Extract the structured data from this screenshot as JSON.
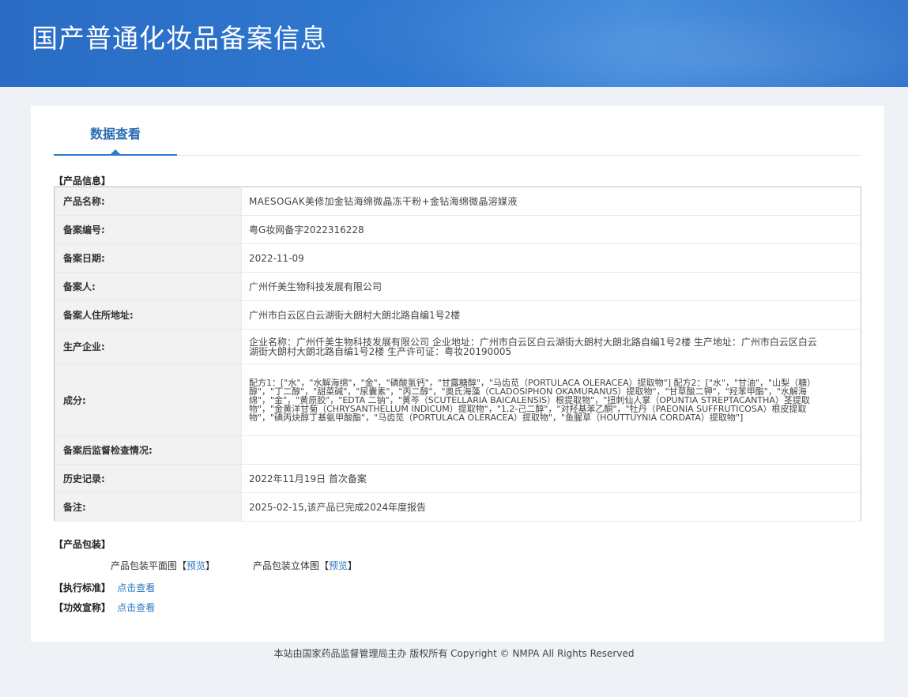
{
  "header": {
    "title": "国产普通化妆品备案信息"
  },
  "tabs": [
    {
      "label": "数据查看"
    }
  ],
  "product_info": {
    "section_title": "【产品信息】",
    "rows": [
      {
        "label": "产品名称:",
        "value": "MAESOGAK美修加金钻海绵微晶冻干粉+金钻海绵微晶溶媒液"
      },
      {
        "label": "备案编号:",
        "value": "粤G妆网备字2022316228"
      },
      {
        "label": "备案日期:",
        "value": "2022-11-09"
      },
      {
        "label": "备案人:",
        "value": "广州仟美生物科技发展有限公司"
      },
      {
        "label": "备案人住所地址:",
        "value": "广州市白云区白云湖街大朗村大朗北路自编1号2楼"
      },
      {
        "label": "生产企业:",
        "value": "企业名称：广州仟美生物科技发展有限公司 企业地址：广州市白云区白云湖街大朗村大朗北路自编1号2楼 生产地址：广州市白云区白云湖街大朗村大朗北路自编1号2楼 生产许可证：粤妆20190005"
      },
      {
        "label": "成分:",
        "value": "配方1：[\"水\"，\"水解海绵\"，\"金\"，\"磷酸氢钙\"，\"甘露糖醇\"，\"马齿苋（PORTULACA OLERACEA）提取物\"] 配方2：[\"水\"，\"甘油\"，\"山梨（糖）醇\"，\"丁二醇\"，\"甜菜碱\"，\"尿囊素\"，\"丙二醇\"，\"奥氏海藻（CLADOSIPHON OKAMURANUS）提取物\"，\"甘草酸二钾\"，\"羟苯甲酯\"，\"水解海绵\"，\"金\"，\"黄原胶\"，\"EDTA 二钠\"，\"黄芩（SCUTELLARIA BAICALENSIS）根提取物\"，\"扭刺仙人掌（OPUNTIA STREPTACANTHA）茎提取物\"，\"金黄洋甘菊（CHRYSANTHELLUM INDICUM）提取物\"，\"1,2-己二醇\"，\"对羟基苯乙酮\"，\"牡丹（PAEONIA SUFFRUTICOSA）根皮提取物\"，\"碘丙炔醇丁基氨甲酸酯\"，\"马齿苋（PORTULACA OLERACEA）提取物\"，\"鱼腥草（HOUTTUYNIA CORDATA）提取物\"]"
      },
      {
        "label": "备案后监督检查情况:",
        "value": ""
      },
      {
        "label": "历史记录:",
        "value": "2022年11月19日 首次备案"
      },
      {
        "label": "备注:",
        "value": "2025-02-15,该产品已完成2024年度报告"
      }
    ]
  },
  "packaging": {
    "section_title": "【产品包装】",
    "flat_label": "产品包装平面图",
    "solid_label": "产品包装立体图",
    "bracket_open": "【",
    "bracket_close": "】",
    "preview_label": "预览"
  },
  "standard": {
    "label": "【执行标准】",
    "link": "点击查看"
  },
  "efficacy": {
    "label": "【功效宣称】",
    "link": "点击查看"
  },
  "footer": {
    "text": "本站由国家药品监督管理局主办 版权所有 Copyright © NMPA All Rights Reserved"
  },
  "colors": {
    "banner": "#2f78d0",
    "link": "#2a78c0",
    "tab": "#2a6bb2",
    "label_bg": "#f2f2f2",
    "table_border": "#a9c2de"
  }
}
